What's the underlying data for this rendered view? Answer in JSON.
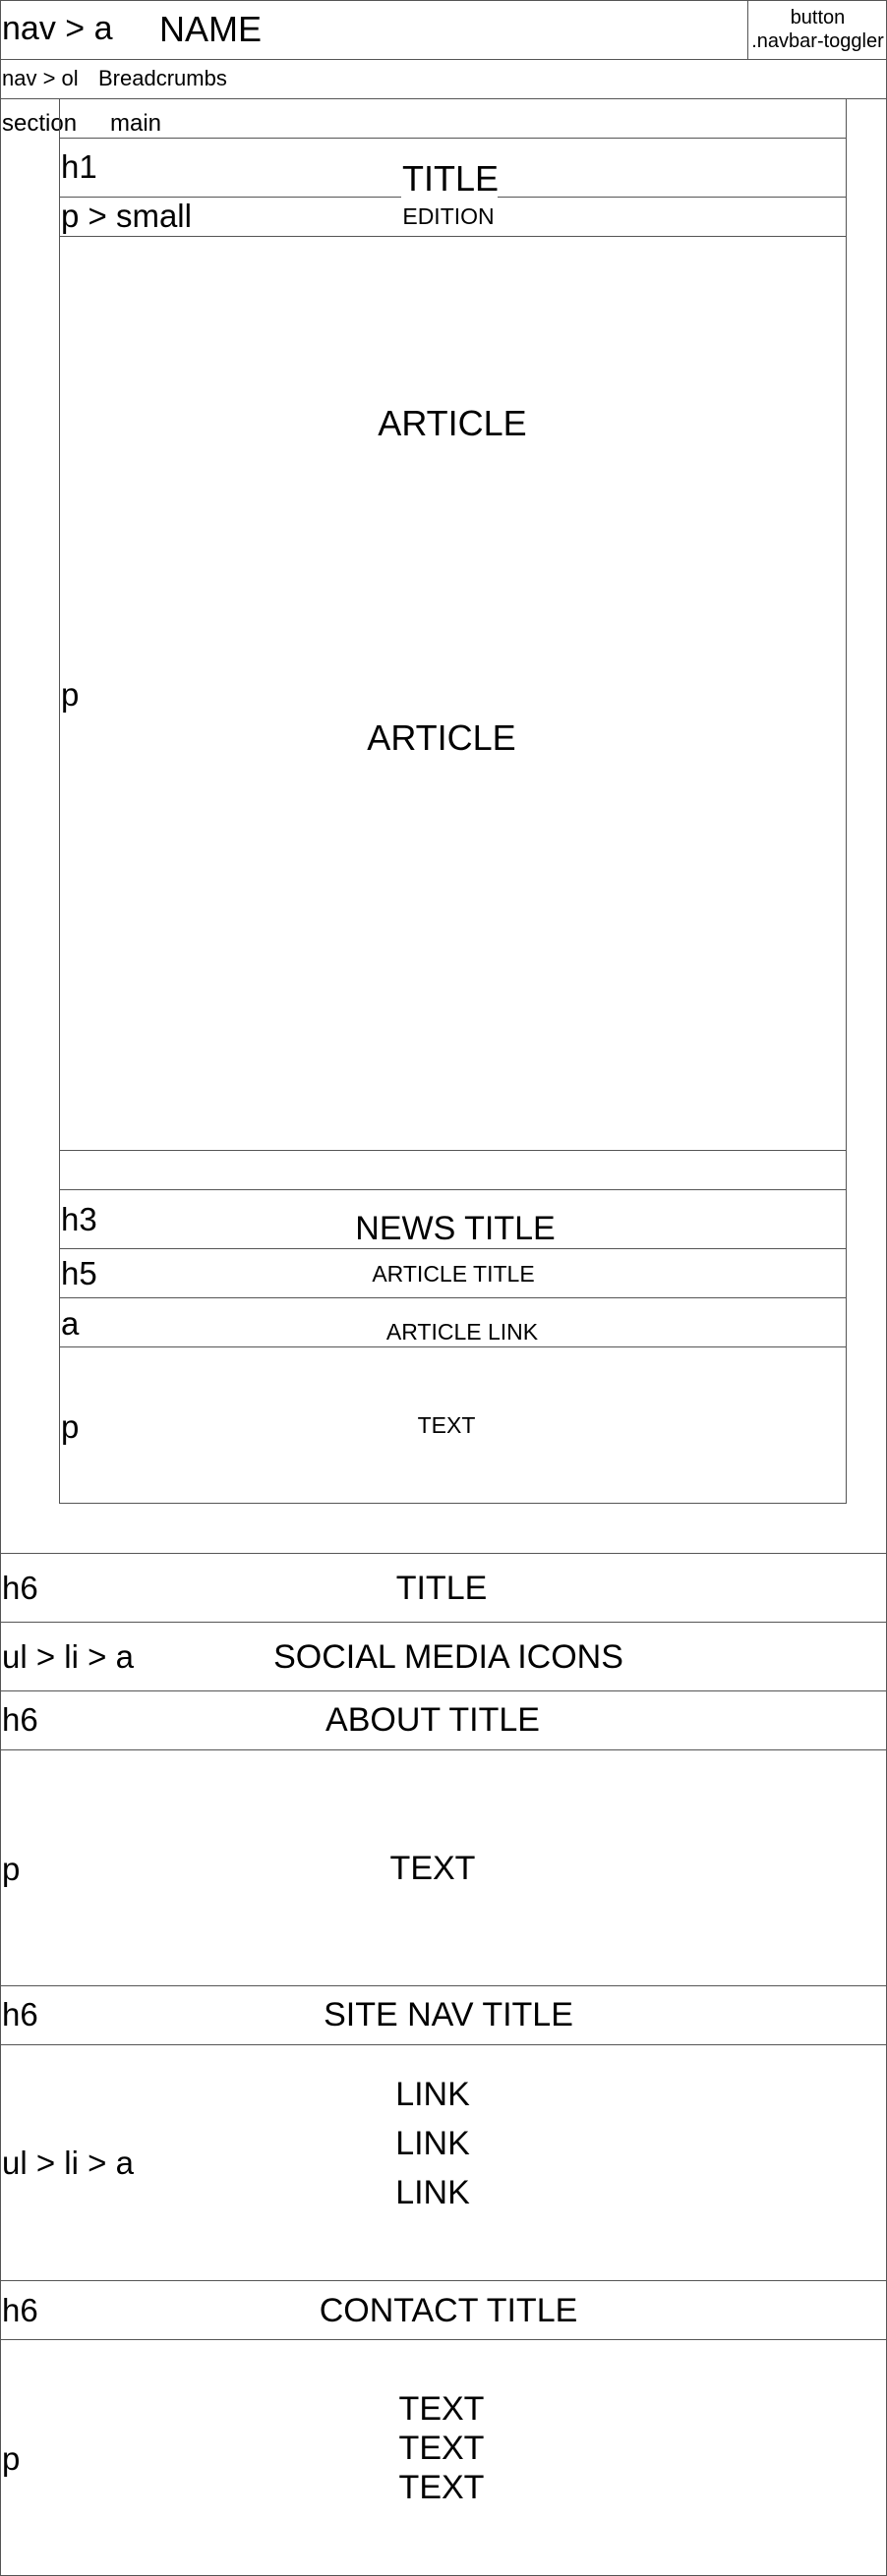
{
  "nav": {
    "tag": "nav > a",
    "name": "NAME",
    "toggler_line1": "button",
    "toggler_line2": ".navbar-toggler"
  },
  "breadcrumbs": {
    "tag": "nav > ol",
    "label": "Breadcrumbs"
  },
  "section": {
    "tag": "section",
    "main": "main"
  },
  "article": {
    "h1_tag": "h1",
    "title": "TITLE",
    "small_tag": "p > small",
    "edition": "EDITION",
    "p_tag": "p",
    "body_1": "ARTICLE",
    "body_2": "ARTICLE"
  },
  "news": {
    "h3_tag": "h3",
    "news_title": "NEWS TITLE",
    "h5_tag": "h5",
    "article_title": "ARTICLE TITLE",
    "a_tag": "a",
    "article_link": "ARTICLE LINK",
    "p_tag": "p",
    "text": "TEXT"
  },
  "footer": {
    "h6_tag_1": "h6",
    "title": "TITLE",
    "ul_tag_1": "ul > li > a",
    "social": "SOCIAL MEDIA ICONS",
    "h6_tag_2": "h6",
    "about_title": "ABOUT TITLE",
    "p_tag_1": "p",
    "about_text": "TEXT",
    "h6_tag_3": "h6",
    "site_nav_title": "SITE NAV TITLE",
    "ul_tag_2": "ul > li > a",
    "links": [
      "LINK",
      "LINK",
      "LINK"
    ],
    "h6_tag_4": "h6",
    "contact_title": "CONTACT TITLE",
    "p_tag_2": "p",
    "contact_text": [
      "TEXT",
      "TEXT",
      "TEXT"
    ]
  }
}
